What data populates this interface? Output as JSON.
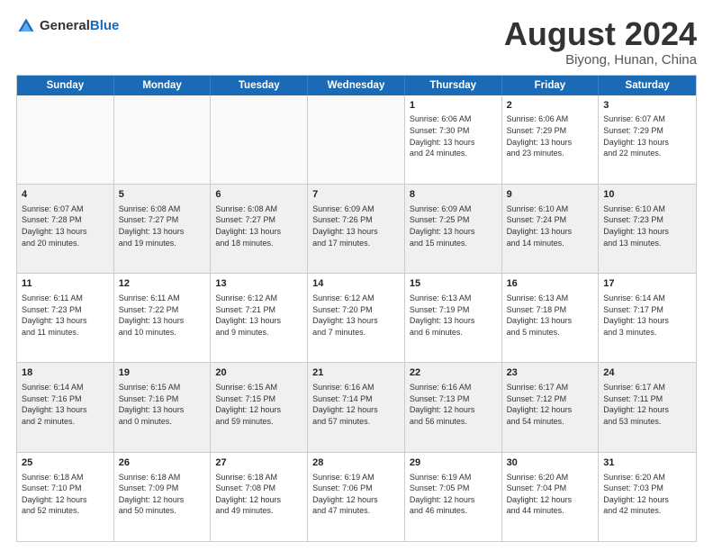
{
  "header": {
    "logo_general": "General",
    "logo_blue": "Blue",
    "title": "August 2024",
    "location": "Biyong, Hunan, China"
  },
  "days_of_week": [
    "Sunday",
    "Monday",
    "Tuesday",
    "Wednesday",
    "Thursday",
    "Friday",
    "Saturday"
  ],
  "weeks": [
    [
      {
        "day": "",
        "info": "",
        "empty": true
      },
      {
        "day": "",
        "info": "",
        "empty": true
      },
      {
        "day": "",
        "info": "",
        "empty": true
      },
      {
        "day": "",
        "info": "",
        "empty": true
      },
      {
        "day": "1",
        "info": "Sunrise: 6:06 AM\nSunset: 7:30 PM\nDaylight: 13 hours\nand 24 minutes.",
        "shaded": false
      },
      {
        "day": "2",
        "info": "Sunrise: 6:06 AM\nSunset: 7:29 PM\nDaylight: 13 hours\nand 23 minutes.",
        "shaded": false
      },
      {
        "day": "3",
        "info": "Sunrise: 6:07 AM\nSunset: 7:29 PM\nDaylight: 13 hours\nand 22 minutes.",
        "shaded": false
      }
    ],
    [
      {
        "day": "4",
        "info": "Sunrise: 6:07 AM\nSunset: 7:28 PM\nDaylight: 13 hours\nand 20 minutes.",
        "shaded": true
      },
      {
        "day": "5",
        "info": "Sunrise: 6:08 AM\nSunset: 7:27 PM\nDaylight: 13 hours\nand 19 minutes.",
        "shaded": true
      },
      {
        "day": "6",
        "info": "Sunrise: 6:08 AM\nSunset: 7:27 PM\nDaylight: 13 hours\nand 18 minutes.",
        "shaded": true
      },
      {
        "day": "7",
        "info": "Sunrise: 6:09 AM\nSunset: 7:26 PM\nDaylight: 13 hours\nand 17 minutes.",
        "shaded": true
      },
      {
        "day": "8",
        "info": "Sunrise: 6:09 AM\nSunset: 7:25 PM\nDaylight: 13 hours\nand 15 minutes.",
        "shaded": true
      },
      {
        "day": "9",
        "info": "Sunrise: 6:10 AM\nSunset: 7:24 PM\nDaylight: 13 hours\nand 14 minutes.",
        "shaded": true
      },
      {
        "day": "10",
        "info": "Sunrise: 6:10 AM\nSunset: 7:23 PM\nDaylight: 13 hours\nand 13 minutes.",
        "shaded": true
      }
    ],
    [
      {
        "day": "11",
        "info": "Sunrise: 6:11 AM\nSunset: 7:23 PM\nDaylight: 13 hours\nand 11 minutes.",
        "shaded": false
      },
      {
        "day": "12",
        "info": "Sunrise: 6:11 AM\nSunset: 7:22 PM\nDaylight: 13 hours\nand 10 minutes.",
        "shaded": false
      },
      {
        "day": "13",
        "info": "Sunrise: 6:12 AM\nSunset: 7:21 PM\nDaylight: 13 hours\nand 9 minutes.",
        "shaded": false
      },
      {
        "day": "14",
        "info": "Sunrise: 6:12 AM\nSunset: 7:20 PM\nDaylight: 13 hours\nand 7 minutes.",
        "shaded": false
      },
      {
        "day": "15",
        "info": "Sunrise: 6:13 AM\nSunset: 7:19 PM\nDaylight: 13 hours\nand 6 minutes.",
        "shaded": false
      },
      {
        "day": "16",
        "info": "Sunrise: 6:13 AM\nSunset: 7:18 PM\nDaylight: 13 hours\nand 5 minutes.",
        "shaded": false
      },
      {
        "day": "17",
        "info": "Sunrise: 6:14 AM\nSunset: 7:17 PM\nDaylight: 13 hours\nand 3 minutes.",
        "shaded": false
      }
    ],
    [
      {
        "day": "18",
        "info": "Sunrise: 6:14 AM\nSunset: 7:16 PM\nDaylight: 13 hours\nand 2 minutes.",
        "shaded": true
      },
      {
        "day": "19",
        "info": "Sunrise: 6:15 AM\nSunset: 7:16 PM\nDaylight: 13 hours\nand 0 minutes.",
        "shaded": true
      },
      {
        "day": "20",
        "info": "Sunrise: 6:15 AM\nSunset: 7:15 PM\nDaylight: 12 hours\nand 59 minutes.",
        "shaded": true
      },
      {
        "day": "21",
        "info": "Sunrise: 6:16 AM\nSunset: 7:14 PM\nDaylight: 12 hours\nand 57 minutes.",
        "shaded": true
      },
      {
        "day": "22",
        "info": "Sunrise: 6:16 AM\nSunset: 7:13 PM\nDaylight: 12 hours\nand 56 minutes.",
        "shaded": true
      },
      {
        "day": "23",
        "info": "Sunrise: 6:17 AM\nSunset: 7:12 PM\nDaylight: 12 hours\nand 54 minutes.",
        "shaded": true
      },
      {
        "day": "24",
        "info": "Sunrise: 6:17 AM\nSunset: 7:11 PM\nDaylight: 12 hours\nand 53 minutes.",
        "shaded": true
      }
    ],
    [
      {
        "day": "25",
        "info": "Sunrise: 6:18 AM\nSunset: 7:10 PM\nDaylight: 12 hours\nand 52 minutes.",
        "shaded": false
      },
      {
        "day": "26",
        "info": "Sunrise: 6:18 AM\nSunset: 7:09 PM\nDaylight: 12 hours\nand 50 minutes.",
        "shaded": false
      },
      {
        "day": "27",
        "info": "Sunrise: 6:18 AM\nSunset: 7:08 PM\nDaylight: 12 hours\nand 49 minutes.",
        "shaded": false
      },
      {
        "day": "28",
        "info": "Sunrise: 6:19 AM\nSunset: 7:06 PM\nDaylight: 12 hours\nand 47 minutes.",
        "shaded": false
      },
      {
        "day": "29",
        "info": "Sunrise: 6:19 AM\nSunset: 7:05 PM\nDaylight: 12 hours\nand 46 minutes.",
        "shaded": false
      },
      {
        "day": "30",
        "info": "Sunrise: 6:20 AM\nSunset: 7:04 PM\nDaylight: 12 hours\nand 44 minutes.",
        "shaded": false
      },
      {
        "day": "31",
        "info": "Sunrise: 6:20 AM\nSunset: 7:03 PM\nDaylight: 12 hours\nand 42 minutes.",
        "shaded": false
      }
    ]
  ]
}
